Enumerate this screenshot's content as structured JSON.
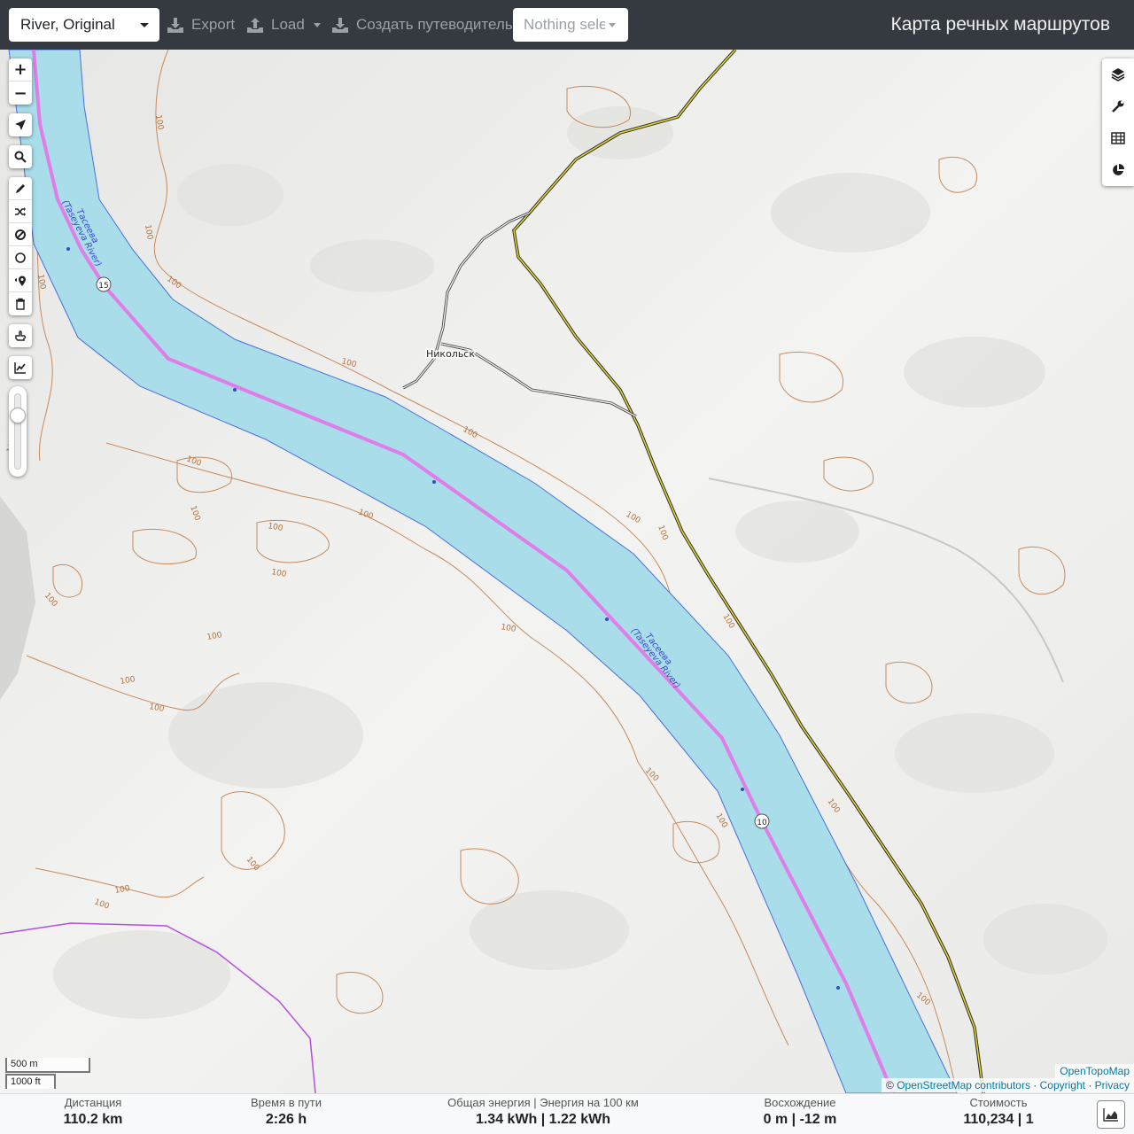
{
  "topbar": {
    "profile": "River, Original",
    "export": "Export",
    "load": "Load",
    "guide": "Создать путеводитель",
    "track_select": "Nothing selected",
    "title": "Карта речных маршрутов"
  },
  "map": {
    "labels": {
      "river_name": "Тасеева",
      "river_name_en": "(Taseyeva River)",
      "village": "Никольск",
      "contour": "100",
      "km_15": "15",
      "km_10": "10"
    },
    "controls": {
      "zoom_in": "+",
      "zoom_out": "−"
    },
    "scale_metric": "500 m",
    "scale_imperial": "1000 ft",
    "attribution_tiles": "OpenTopoMap",
    "attribution_prefix": "© ",
    "attribution_osm": "OpenStreetMap contributors",
    "attribution_sep1": " · ",
    "attribution_copyright": "Copyright",
    "attribution_sep2": " · ",
    "attribution_privacy": "Privacy",
    "colors": {
      "water": "#a8dde9",
      "water_edge": "#4a6fe0",
      "route": "#e07de8",
      "contour": "#c98a5a",
      "road": "#2b2b2b",
      "road_yellow": "#d9c81a",
      "boundary": "#b64fe0"
    }
  },
  "stats": {
    "distance_label": "Дистанция",
    "distance_value": "110.2 km",
    "time_label": "Время в пути",
    "time_value": "2:26 h",
    "energy_label": "Общая энергия | Энергия на 100 км",
    "energy_value": "1.34 kWh | 1.22 kWh",
    "ascent_label": "Восхождение",
    "ascent_value": "0 m | -12 m",
    "cost_label": "Стоимость",
    "cost_value": "110,234 | 1"
  }
}
